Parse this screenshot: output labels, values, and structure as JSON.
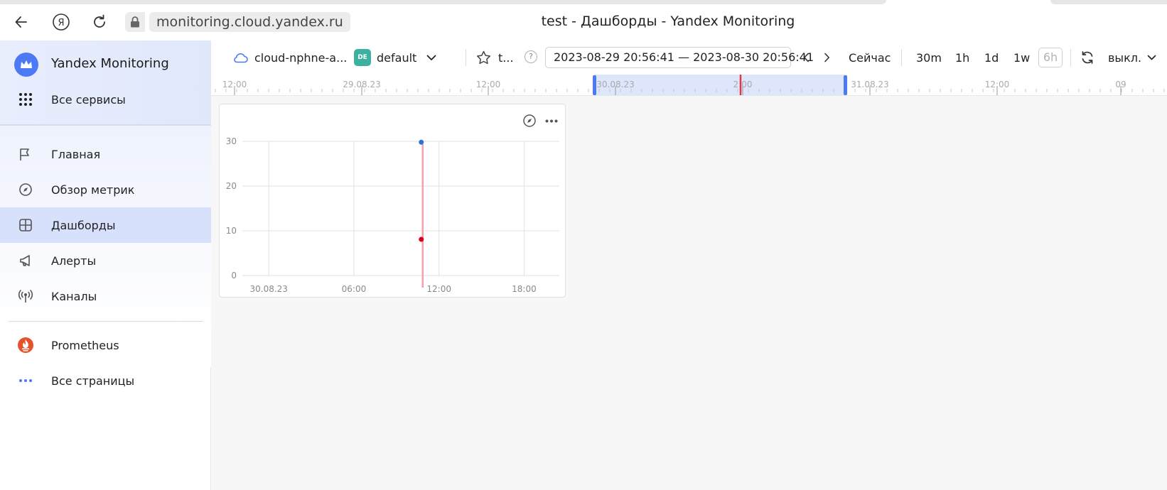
{
  "browser": {
    "url": "monitoring.cloud.yandex.ru",
    "page_title": "test - Дашборды - Yandex Monitoring"
  },
  "sidebar": {
    "title": "Yandex Monitoring",
    "all_services": "Все сервисы",
    "items": [
      {
        "label": "Главная",
        "icon": "flag-icon"
      },
      {
        "label": "Обзор метрик",
        "icon": "compass-icon"
      },
      {
        "label": "Дашборды",
        "icon": "dashboard-grid-icon",
        "active": true
      },
      {
        "label": "Алерты",
        "icon": "megaphone-icon"
      },
      {
        "label": "Каналы",
        "icon": "broadcast-icon"
      }
    ],
    "extra": [
      {
        "label": "Prometheus",
        "icon": "prometheus-icon"
      },
      {
        "label": "Все страницы",
        "icon": "more-horizontal-icon"
      }
    ]
  },
  "toolbar": {
    "cloud": "cloud-nphne-a...",
    "folder_badge": "DE",
    "folder": "default",
    "dashboard_short": "t...",
    "help": "?",
    "range": "2023-08-29 20:56:41 — 2023-08-30 20:56:41",
    "now": "Сейчас",
    "presets": [
      "30m",
      "1h",
      "1d",
      "1w",
      "6h"
    ],
    "refresh_label": "выкл."
  },
  "timeline": {
    "ticks": [
      "12:00",
      "29.08.23",
      "12:00",
      "30.08.23",
      "2:00",
      "31.08.23",
      "12:00",
      "09"
    ],
    "selection_color": "#4d79f5",
    "now_color": "#e3364b"
  },
  "chart_data": {
    "type": "scatter",
    "x_tick_labels": [
      "30.08.23",
      "06:00",
      "12:00",
      "18:00"
    ],
    "y_ticks": [
      0,
      10,
      20,
      30
    ],
    "ylim": [
      0,
      30
    ],
    "grid": true,
    "points": [
      {
        "x": "2023-08-30 10:45",
        "y": 29.8,
        "color": "#2a73d9"
      },
      {
        "x": "2023-08-30 10:45",
        "y": 8.1,
        "color": "#d9001b"
      }
    ],
    "now_line": {
      "x": "2023-08-30 10:45",
      "color": "#f4a0a8"
    }
  }
}
